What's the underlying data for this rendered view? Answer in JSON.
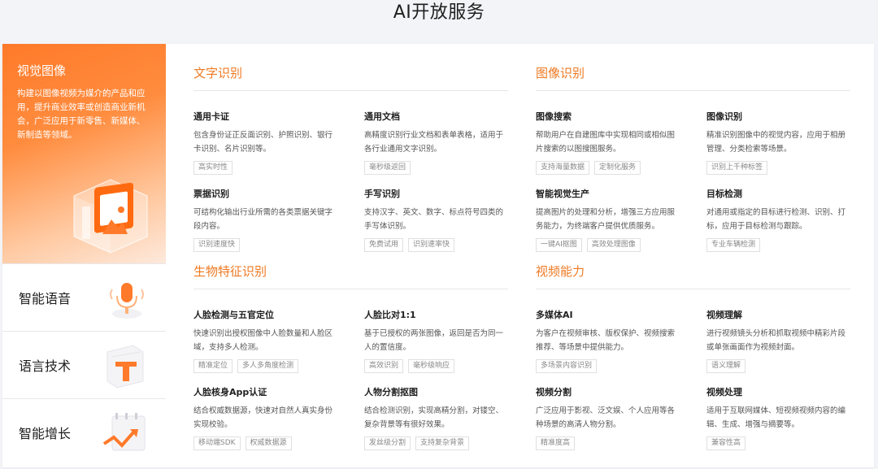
{
  "page": {
    "title": "AI开放服务"
  },
  "sidebar": {
    "active": {
      "title": "视觉图像",
      "desc": "构建以图像视频为媒介的产品和应用，提升商业效率或创造商业新机会，广泛应用于新零售、新媒体、新制造等领域。"
    },
    "items": [
      {
        "label": "智能语音",
        "icon": "microphone-icon"
      },
      {
        "label": "语言技术",
        "icon": "text-t-icon"
      },
      {
        "label": "智能增长",
        "icon": "calendar-chart-icon"
      }
    ]
  },
  "sections": [
    {
      "title": "文字识别",
      "cards": [
        {
          "name": "通用卡证",
          "desc": "包含身份证正反面识别、护照识别、银行卡识别、名片识别等。",
          "tags": [
            "高实时性"
          ]
        },
        {
          "name": "通用文档",
          "desc": "高精度识别行业文档和表单表格，适用于各行业通用文字识别。",
          "tags": [
            "毫秒级返回"
          ]
        },
        {
          "name": "票据识别",
          "desc": "可结构化输出行业所需的各类票据关键字段内容。",
          "tags": [
            "识别速度快"
          ]
        },
        {
          "name": "手写识别",
          "desc": "支持汉字、英文、数字、标点符号四类的手写体识别。",
          "tags": [
            "免费试用",
            "识别速率快"
          ]
        }
      ]
    },
    {
      "title": "图像识别",
      "cards": [
        {
          "name": "图像搜索",
          "desc": "帮助用户在自建图库中实现相同或相似图片搜索的以图搜图服务。",
          "tags": [
            "支持海量数据",
            "定制化服务"
          ]
        },
        {
          "name": "图像识别",
          "desc": "精准识别图像中的视觉内容，应用于相册管理、分类检索等场景。",
          "tags": [
            "识别上千种标签"
          ]
        },
        {
          "name": "智能视觉生产",
          "desc": "提高图片的处理和分析，增强三方应用服务能力，为终端客户提供优质服务。",
          "tags": [
            "一键AI抠图",
            "高效处理图像"
          ]
        },
        {
          "name": "目标检测",
          "desc": "对通用或指定的目标进行检测、识别、打标，应用于目标检测与跟踪。",
          "tags": [
            "专业车辆检测"
          ]
        }
      ]
    },
    {
      "title": "生物特征识别",
      "cards": [
        {
          "name": "人脸检测与五官定位",
          "desc": "快速识别出授权图像中人脸数量和人脸区域，支持多人检测。",
          "tags": [
            "精准定位",
            "多人多角度检测"
          ]
        },
        {
          "name": "人脸比对1:1",
          "desc": "基于已授权的两张图像，返回是否为同一人的置信度。",
          "tags": [
            "高效识别",
            "毫秒级响应"
          ]
        },
        {
          "name": "人脸核身App认证",
          "desc": "结合权威数据源，快速对自然人真实身份实现校验。",
          "tags": [
            "移动端SDK",
            "权威数据源"
          ]
        },
        {
          "name": "人物分割抠图",
          "desc": "结合检测识别，实现高精分割，对镂空、复杂背景等有很好效果。",
          "tags": [
            "发丝级分割",
            "支持复杂背景"
          ]
        }
      ]
    },
    {
      "title": "视频能力",
      "cards": [
        {
          "name": "多媒体AI",
          "desc": "为客户在视频审核、版权保护、视频搜索推荐、等场景中提供能力。",
          "tags": [
            "多场景内容识别"
          ]
        },
        {
          "name": "视频理解",
          "desc": "进行视频镜头分析和抓取视频中精彩片段或单张画面作为视频封面。",
          "tags": [
            "语义理解"
          ]
        },
        {
          "name": "视频分割",
          "desc": "广泛应用于影视、泛文娱、个人应用等各种场景的高清人物分割。",
          "tags": [
            "精准度高"
          ]
        },
        {
          "name": "视频处理",
          "desc": "适用于互联网媒体、短视频视频内容的编辑、生成、增强与摘要等。",
          "tags": [
            "兼容性高"
          ]
        }
      ]
    }
  ],
  "colors": {
    "accent": "#ee7a23",
    "sidebar_gradient_start": "#ff7a2a"
  }
}
